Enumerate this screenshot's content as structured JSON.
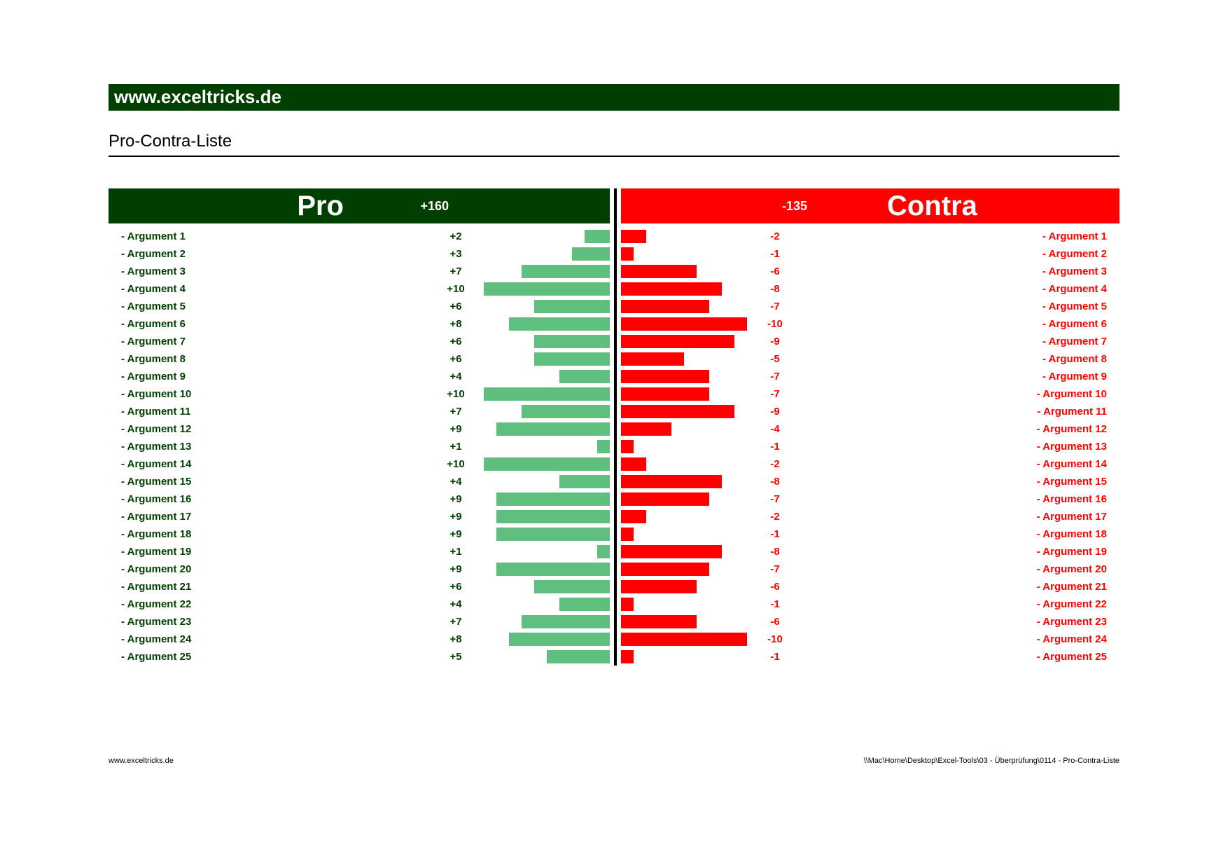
{
  "site": "www.exceltricks.de",
  "title": "Pro-Contra-Liste",
  "pro_header": "Pro",
  "contra_header": "Contra",
  "pro_sum": "+160",
  "contra_sum": "-135",
  "footer_left": "www.exceltricks.de",
  "footer_right": "\\\\Mac\\Home\\Desktop\\Excel-Tools\\03 - Überprüfung\\0114 - Pro-Contra-Liste",
  "chart_data": {
    "type": "bar",
    "title": "Pro-Contra-Liste",
    "max_abs": 10,
    "series": [
      {
        "name": "Pro",
        "color": "#5fbf7f",
        "values": [
          2,
          3,
          7,
          10,
          6,
          8,
          6,
          6,
          4,
          10,
          7,
          9,
          1,
          10,
          4,
          9,
          9,
          9,
          1,
          9,
          6,
          4,
          7,
          8,
          5
        ]
      },
      {
        "name": "Contra",
        "color": "#ff0000",
        "values": [
          -2,
          -1,
          -6,
          -8,
          -7,
          -10,
          -9,
          -5,
          -7,
          -7,
          -9,
          -4,
          -1,
          -2,
          -8,
          -7,
          -2,
          -1,
          -8,
          -7,
          -6,
          -1,
          -6,
          -10,
          -1
        ]
      }
    ],
    "categories": [
      "Argument 1",
      "Argument 2",
      "Argument 3",
      "Argument 4",
      "Argument 5",
      "Argument 6",
      "Argument 7",
      "Argument 8",
      "Argument 9",
      "Argument 10",
      "Argument 11",
      "Argument 12",
      "Argument 13",
      "Argument 14",
      "Argument 15",
      "Argument 16",
      "Argument 17",
      "Argument 18",
      "Argument 19",
      "Argument 20",
      "Argument 21",
      "Argument 22",
      "Argument 23",
      "Argument 24",
      "Argument 25"
    ],
    "sums": {
      "pro": 160,
      "contra": -135
    }
  }
}
